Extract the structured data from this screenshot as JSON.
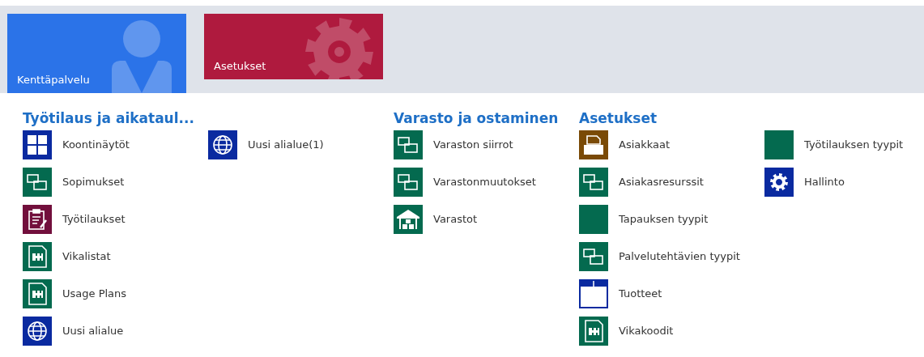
{
  "tiles": [
    {
      "label": "Kenttäpalvelu",
      "kind": "person",
      "color": "#2b73e8",
      "selected": true
    },
    {
      "label": "Asetukset",
      "kind": "gear",
      "color": "#af1a3e",
      "selected": false
    }
  ],
  "groups": [
    {
      "title": "Työtilaus ja aikataul...",
      "columns": [
        [
          {
            "label": "Koontinäytöt",
            "kind": "dashboard",
            "color": "#0a2aa0"
          },
          {
            "label": "Sopimukset",
            "kind": "windows",
            "color": "#046a4f"
          },
          {
            "label": "Työtilaukset",
            "kind": "clipboard",
            "color": "#720f3c"
          },
          {
            "label": "Vikalistat",
            "kind": "puzzle",
            "color": "#046a4f"
          },
          {
            "label": "Usage Plans",
            "kind": "puzzle",
            "color": "#046a4f"
          },
          {
            "label": "Uusi alialue",
            "kind": "globe",
            "color": "#0a2aa0"
          }
        ],
        [
          {
            "label": "Uusi alialue(1)",
            "kind": "globe",
            "color": "#0a2aa0"
          }
        ]
      ]
    },
    {
      "title": "Varasto ja ostaminen",
      "columns": [
        [
          {
            "label": "Varaston siirrot",
            "kind": "windows",
            "color": "#046a4f"
          },
          {
            "label": "Varastonmuutokset",
            "kind": "windows",
            "color": "#046a4f"
          },
          {
            "label": "Varastot",
            "kind": "warehouse",
            "color": "#046a4f"
          }
        ]
      ]
    },
    {
      "title": "Asetukset",
      "columns": [
        [
          {
            "label": "Asiakkaat",
            "kind": "folder",
            "color": "#7a4a06"
          },
          {
            "label": "Asiakasresurssit",
            "kind": "windows",
            "color": "#046a4f"
          },
          {
            "label": "Tapauksen tyypit",
            "kind": "plain",
            "color": "#046a4f"
          },
          {
            "label": "Palvelutehtävien tyypit",
            "kind": "windows",
            "color": "#046a4f"
          },
          {
            "label": "Tuotteet",
            "kind": "box",
            "color": "#0a2aa0"
          },
          {
            "label": "Vikakoodit",
            "kind": "puzzle",
            "color": "#046a4f"
          }
        ],
        [
          {
            "label": "Työtilauksen tyypit",
            "kind": "plain",
            "color": "#046a4f"
          },
          {
            "label": "Hallinto",
            "kind": "gear",
            "color": "#0a2aa0"
          }
        ]
      ]
    }
  ]
}
